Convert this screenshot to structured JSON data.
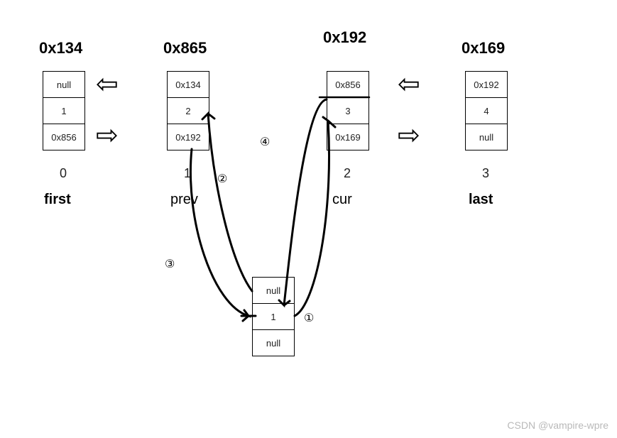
{
  "nodes": [
    {
      "address": "0x134",
      "cells": {
        "prev": "null",
        "val": "1",
        "next": "0x856"
      },
      "index": "0",
      "role": "first",
      "role_bold": true
    },
    {
      "address": "0x865",
      "cells": {
        "prev": "0x134",
        "val": "2",
        "next": "0x192"
      },
      "index": "1",
      "role": "prev",
      "role_bold": false
    },
    {
      "address": "0x192",
      "cells": {
        "prev": "0x856",
        "val": "3",
        "next": "0x169"
      },
      "index": "2",
      "role": "cur",
      "role_bold": false
    },
    {
      "address": "0x169",
      "cells": {
        "prev": "0x192",
        "val": "4",
        "next": "null"
      },
      "index": "3",
      "role": "last",
      "role_bold": true
    }
  ],
  "new_node": {
    "cells": {
      "prev": "null",
      "val": "1",
      "next": "null"
    }
  },
  "steps": {
    "s1": "①",
    "s2": "②",
    "s3": "③",
    "s4": "④"
  },
  "watermark": "CSDN @vampire-wpre",
  "chart_data": {
    "type": "diagram",
    "description": "Doubly linked list node insertion diagram",
    "nodes_top": [
      {
        "addr": "0x134",
        "prev": "null",
        "value": 1,
        "next": "0x856",
        "index": 0,
        "label": "first"
      },
      {
        "addr": "0x865",
        "prev": "0x134",
        "value": 2,
        "next": "0x192",
        "index": 1,
        "label": "prev"
      },
      {
        "addr": "0x192",
        "prev": "0x856",
        "value": 3,
        "next": "0x169",
        "index": 2,
        "label": "cur"
      },
      {
        "addr": "0x169",
        "prev": "0x192",
        "value": 4,
        "next": "null",
        "index": 3,
        "label": "last"
      }
    ],
    "new_node": {
      "prev": "null",
      "value": 1,
      "next": "null"
    },
    "step_arrows": [
      {
        "step": 1,
        "from": "new_node",
        "to": "cur"
      },
      {
        "step": 2,
        "from": "new_node",
        "to": "prev.value"
      },
      {
        "step": 3,
        "from": "prev.next",
        "to": "new_node"
      },
      {
        "step": 4,
        "from": "cur.prev",
        "to": "new_node"
      }
    ],
    "block_arrows_left": [
      "0x134↔0x865",
      "0x192↔0x169"
    ],
    "block_arrows_right": [
      "0x134↔0x865",
      "0x192↔0x169"
    ]
  }
}
